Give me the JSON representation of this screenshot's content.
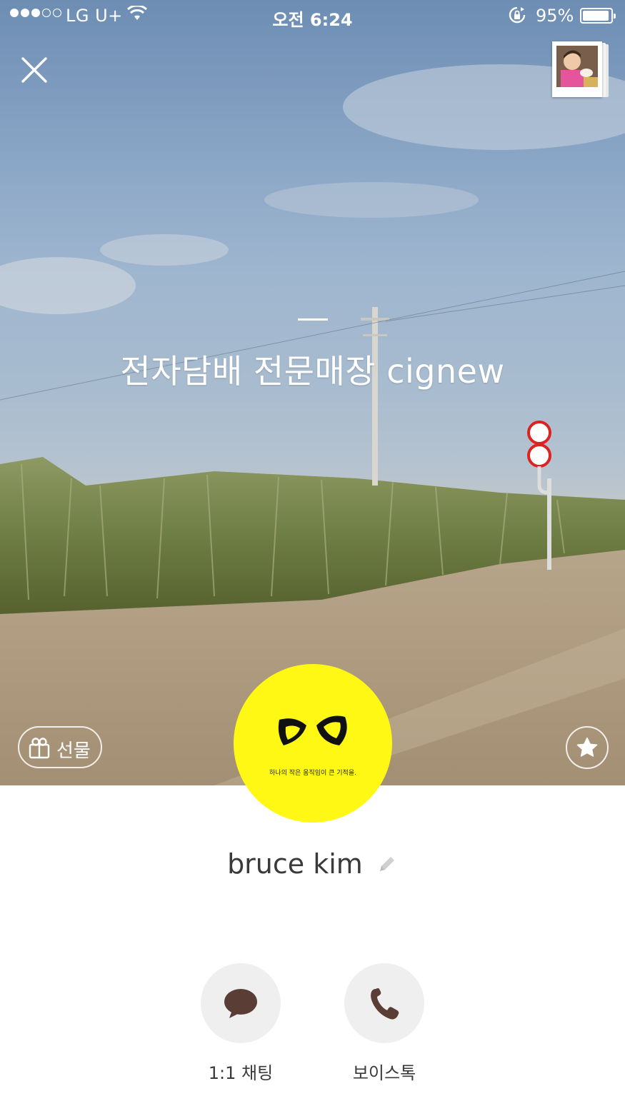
{
  "status_bar": {
    "carrier": "LG U+",
    "time": "오전 6:24",
    "battery": "95%",
    "battery_level": 0.95,
    "signal_bars_filled": 3,
    "signal_bars_total": 5
  },
  "profile": {
    "status_message": "전자담배 전문매장 cignew",
    "name": "bruce kim",
    "avatar_tagline": "하나의 작은 움직임이 큰 기적을."
  },
  "controls": {
    "gift_label": "선물"
  },
  "actions": [
    {
      "label": "1:1 채팅",
      "icon": "chat-bubble-icon"
    },
    {
      "label": "보이스톡",
      "icon": "phone-icon"
    }
  ],
  "colors": {
    "avatar_bg": "#fff814",
    "action_circle": "#efefef",
    "icon_brown": "#5a3e36"
  }
}
